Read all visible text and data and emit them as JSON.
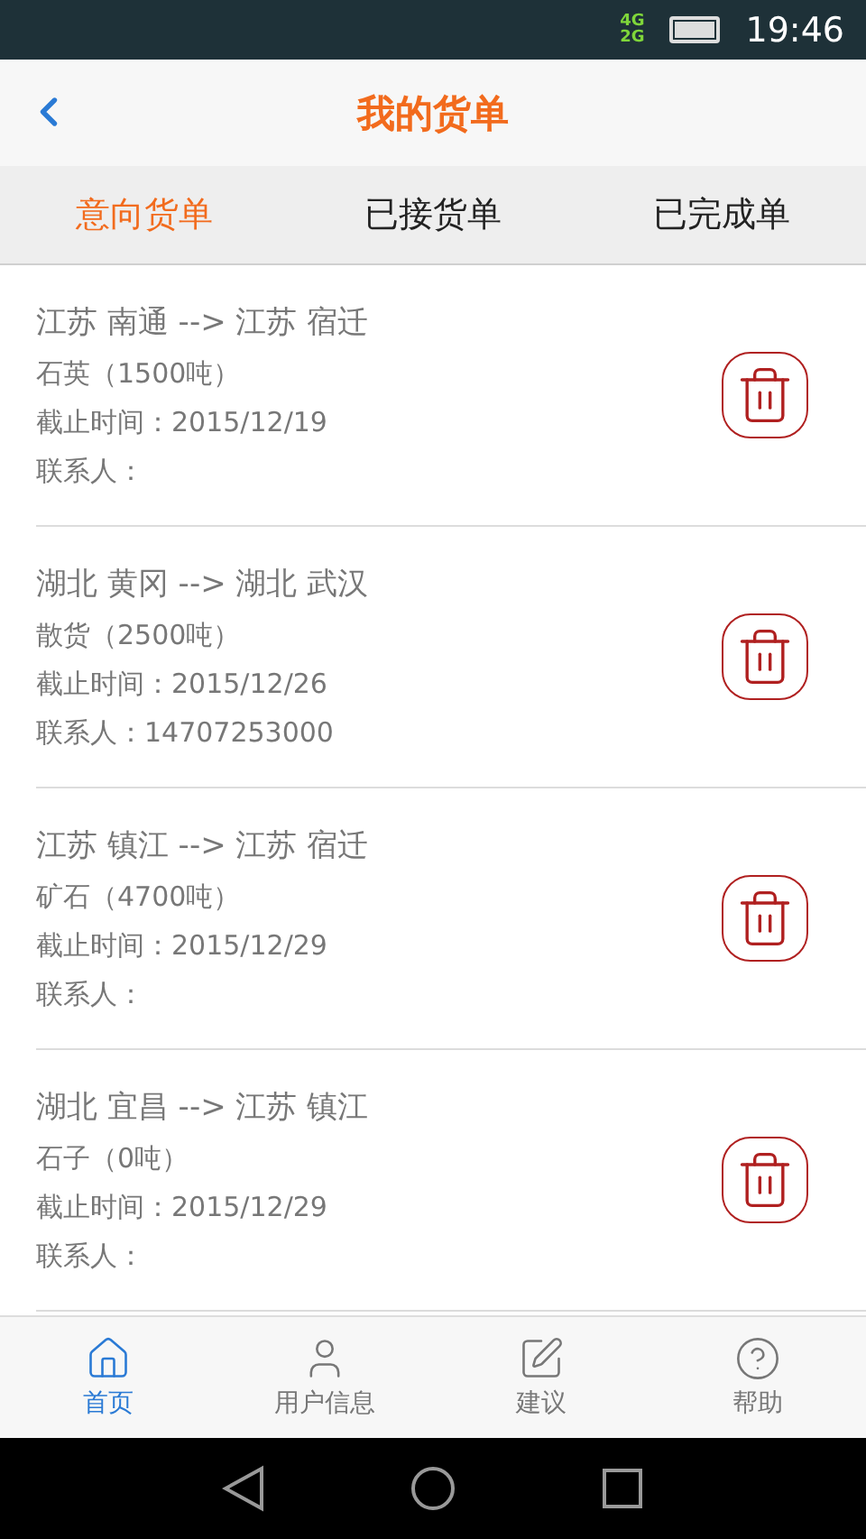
{
  "status_bar": {
    "network": [
      "4G",
      "2G"
    ],
    "time": "19:46"
  },
  "header": {
    "title": "我的货单"
  },
  "tabs": [
    {
      "label": "意向货单",
      "selected": true
    },
    {
      "label": "已接货单",
      "selected": false
    },
    {
      "label": "已完成单",
      "selected": false
    }
  ],
  "orders": [
    {
      "route": "江苏 南通 --> 江苏 宿迁",
      "cargo": "石英（1500吨）",
      "deadline": "截止时间：2015/12/19",
      "contact": "联系人："
    },
    {
      "route": "湖北 黄冈 --> 湖北 武汉",
      "cargo": "散货（2500吨）",
      "deadline": "截止时间：2015/12/26",
      "contact": "联系人：14707253000"
    },
    {
      "route": "江苏 镇江 --> 江苏 宿迁",
      "cargo": "矿石（4700吨）",
      "deadline": "截止时间：2015/12/29",
      "contact": "联系人："
    },
    {
      "route": "湖北 宜昌 --> 江苏 镇江",
      "cargo": "石子（0吨）",
      "deadline": "截止时间：2015/12/29",
      "contact": "联系人："
    }
  ],
  "bottom_nav": [
    {
      "kind": "home",
      "label": "首页",
      "selected": true
    },
    {
      "kind": "user",
      "label": "用户信息",
      "selected": false
    },
    {
      "kind": "edit",
      "label": "建议",
      "selected": false
    },
    {
      "kind": "help",
      "label": "帮助",
      "selected": false
    }
  ]
}
